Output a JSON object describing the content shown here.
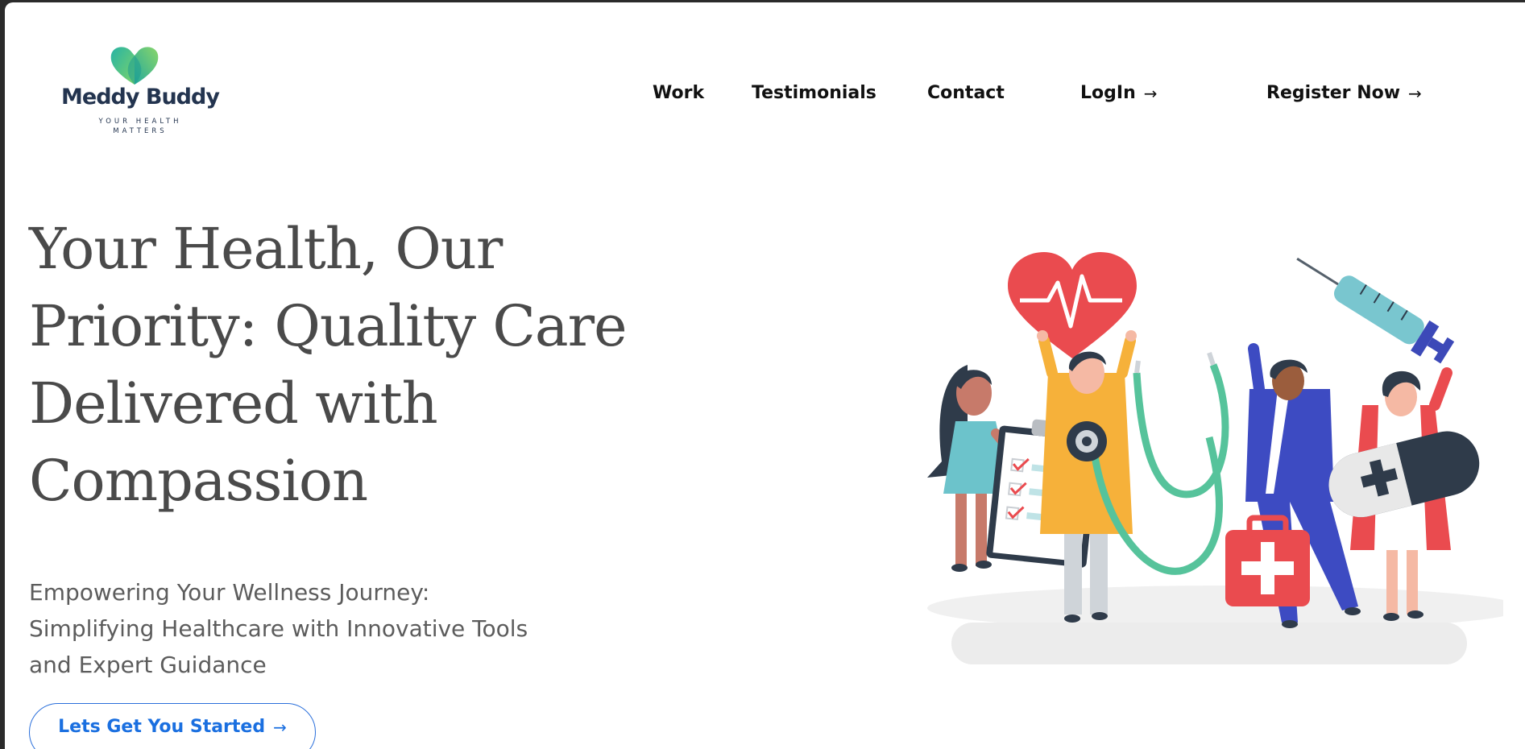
{
  "brand": {
    "name": "Meddy Buddy",
    "tagline": "YOUR HEALTH MATTERS",
    "logo_icon": "heart-logo-icon",
    "colors": {
      "logo_green_1": "#2fb5a0",
      "logo_green_2": "#7cd36b",
      "name": "#23344f"
    }
  },
  "nav": {
    "items": [
      {
        "label": "Work"
      },
      {
        "label": "Testimonials"
      },
      {
        "label": "Contact"
      }
    ],
    "login": {
      "label": "LogIn",
      "icon": "arrow-right-icon"
    },
    "register": {
      "label": "Register Now",
      "icon": "arrow-right-icon"
    }
  },
  "hero": {
    "title": "Your Health, Our Priority: Quality Care Delivered with Compassion",
    "subtitle": "Empowering Your Wellness Journey: Simplifying Healthcare with Innovative Tools and Expert Guidance",
    "cta": {
      "label": "Lets Get You Started",
      "icon": "arrow-right-icon",
      "color": "#1a6fe0"
    }
  },
  "illustration": {
    "name": "medical-team-illustration"
  }
}
